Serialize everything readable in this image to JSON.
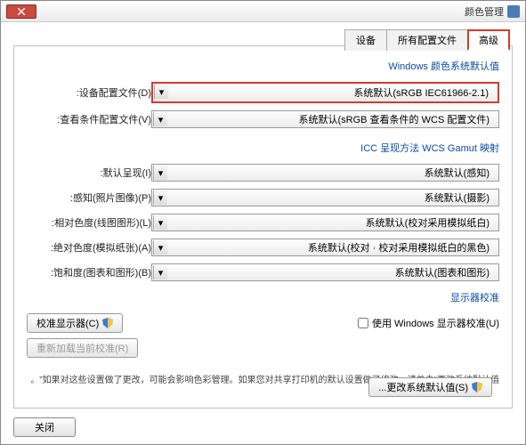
{
  "window": {
    "title": "颜色管理"
  },
  "tabs": {
    "t1": "设备",
    "t2": "所有配置文件",
    "t3": "高级"
  },
  "section1": {
    "title": "Windows 颜色系统默认值",
    "row1_label": "设备配置文件(D):",
    "row1_value": "系统默认(sRGB IEC61966-2.1)",
    "row2_label": "查看条件配置文件(V):",
    "row2_value": "系统默认(sRGB 查看条件的 WCS 配置文件)"
  },
  "section2": {
    "title": "ICC 呈现方法 WCS Gamut 映射",
    "rows": [
      {
        "label": "默认呈现(I):",
        "value": "系统默认(感知)"
      },
      {
        "label": "感知(照片图像)(P):",
        "value": "系统默认(摄影)"
      },
      {
        "label": "相对色度(线图图形)(L):",
        "value": "系统默认(校对采用模拟纸白)"
      },
      {
        "label": "绝对色度(模拟纸张)(A):",
        "value": "系统默认(校对 · 校对采用模拟纸白的黑色)"
      },
      {
        "label": "饱和度(图表和图形)(B):",
        "value": "系统默认(图表和图形)"
      }
    ]
  },
  "display": {
    "title": "显示器校准",
    "btn_calibrate": "校准显示器(C)",
    "chk_label": "使用 Windows 显示器校准(U)",
    "btn_reload": "重新加载当前校准(R)"
  },
  "note": "如果对这些设置做了更改，可能会影响色彩管理。如果您对共享打印机的默认设置做了修改，请单击“更改系统默认值”。",
  "footer": {
    "change_defaults": "更改系统默认值(S)...",
    "close": "关闭"
  }
}
